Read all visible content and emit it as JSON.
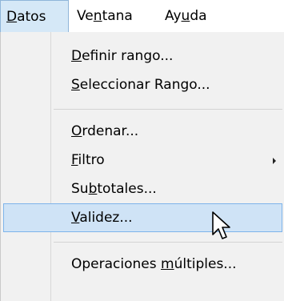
{
  "menubar": {
    "items": [
      {
        "label_pre": "",
        "label_ul": "D",
        "label_post": "atos"
      },
      {
        "label_pre": "Ve",
        "label_ul": "n",
        "label_post": "tana"
      },
      {
        "label_pre": "Ay",
        "label_ul": "u",
        "label_post": "da"
      }
    ]
  },
  "menu": {
    "items": [
      {
        "pre": "",
        "ul": "D",
        "post": "efinir rango..."
      },
      {
        "pre": "",
        "ul": "S",
        "post": "eleccionar Rango..."
      },
      {
        "pre": "",
        "ul": "O",
        "post": "rdenar..."
      },
      {
        "pre": "",
        "ul": "F",
        "post": "iltro"
      },
      {
        "pre": "Su",
        "ul": "b",
        "post": "totales..."
      },
      {
        "pre": "",
        "ul": "V",
        "post": "alidez..."
      },
      {
        "pre": "Operaciones ",
        "ul": "m",
        "post": "últiples..."
      }
    ]
  },
  "colors": {
    "highlight_bg": "#cfe3f6",
    "highlight_border": "#7eb4ea",
    "menu_bg": "#f1f1f1"
  }
}
